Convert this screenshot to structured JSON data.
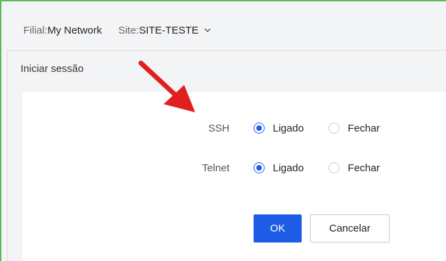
{
  "header": {
    "branch_label": "Filial:",
    "branch_value": "My Network",
    "site_label": "Site:",
    "site_value": "SITE-TESTE"
  },
  "section": {
    "title": "Iniciar sessão"
  },
  "settings": [
    {
      "label": "SSH",
      "options": [
        "Ligado",
        "Fechar"
      ],
      "selected": "Ligado"
    },
    {
      "label": "Telnet",
      "options": [
        "Ligado",
        "Fechar"
      ],
      "selected": "Ligado"
    }
  ],
  "buttons": {
    "ok": "OK",
    "cancel": "Cancelar"
  },
  "colors": {
    "primary": "#1e5ce6",
    "annotation_arrow": "#e02020",
    "frame_accent": "#5cb85c"
  },
  "icons": {
    "site_dropdown": "chevron-down-icon",
    "annotation": "red-arrow-icon"
  }
}
